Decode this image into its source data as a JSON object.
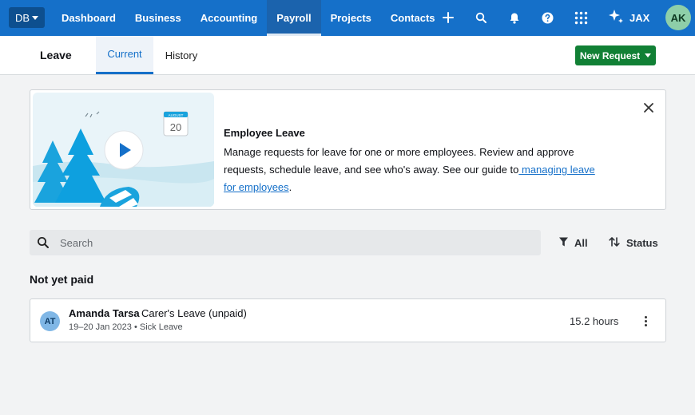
{
  "topnav": {
    "org_label": "DB",
    "links": [
      "Dashboard",
      "Business",
      "Accounting",
      "Payroll",
      "Projects",
      "Contacts"
    ],
    "active_link": "Payroll",
    "assistant_label": "JAX",
    "user_initials": "AK",
    "icons": [
      "plus-icon",
      "search-icon",
      "bell-icon",
      "help-icon",
      "apps-grid-icon",
      "sparkle-icon"
    ]
  },
  "subheader": {
    "title": "Leave",
    "tabs": [
      "Current",
      "History"
    ],
    "active_tab": "Current",
    "new_request_label": "New Request"
  },
  "banner": {
    "calendar_month": "AUGUST",
    "calendar_day": "20",
    "title": "Employee Leave",
    "body_text": "Manage requests for leave for one or more employees. Review and approve requests, schedule leave, and see who's away. See our guide to",
    "link_text": " managing leave for employees",
    "body_end": "."
  },
  "search": {
    "placeholder": "Search"
  },
  "filters": {
    "all_label": "All",
    "status_label": "Status"
  },
  "section": {
    "title": "Not yet paid"
  },
  "leave_items": [
    {
      "initials": "AT",
      "name": "Amanda Tarsa",
      "leave_type": "Carer's Leave (unpaid)",
      "meta": "19–20 Jan 2023 • Sick Leave",
      "hours": "15.2 hours"
    }
  ],
  "colors": {
    "nav_blue": "#1570c9",
    "button_green": "#118035",
    "link_blue": "#1570c9",
    "avatar_green": "#8ecfa9",
    "avatar_blue": "#80b7e6"
  }
}
